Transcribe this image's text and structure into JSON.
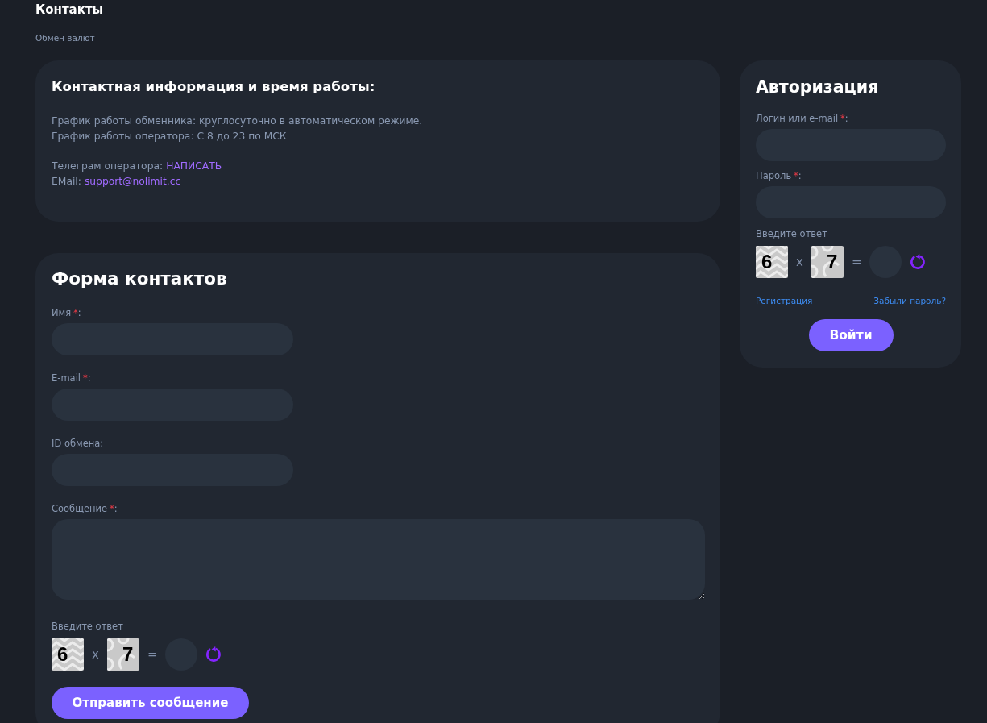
{
  "page": {
    "title": "Контакты",
    "breadcrumb": "Обмен валют"
  },
  "contact_info": {
    "title": "Контактная информация и время работы:",
    "schedule": [
      {
        "text": "График работы обменника: круглосуточно в автоматическом режиме."
      },
      {
        "text": "График работы оператора: С 8 до 23 по МСК"
      }
    ],
    "contacts": [
      {
        "label": "Телеграм оператора:",
        "link": "НАПИСАТЬ"
      },
      {
        "label": "EMail:",
        "link": "support@nolimit.cc"
      }
    ]
  },
  "contact_form": {
    "title": "Форма контактов",
    "fields": [
      {
        "kind": "input",
        "label": "Имя",
        "required_mark": "*",
        "colon": ":"
      },
      {
        "kind": "input",
        "label": "E-mail",
        "required_mark": "*",
        "colon": ":"
      },
      {
        "kind": "input",
        "label": "ID обмена",
        "colon": ":"
      },
      {
        "kind": "textarea",
        "label": "Сообщение",
        "required_mark": "*",
        "colon": ":"
      }
    ],
    "captcha": {
      "label": "Введите ответ",
      "operands": [
        {
          "digit": "6",
          "kind": "zigzag"
        },
        {
          "digit": "7",
          "kind": "rings"
        }
      ],
      "operator": "x",
      "equals": "="
    },
    "submit": "Отправить сообщение"
  },
  "auth": {
    "title": "Авторизация",
    "fields": [
      {
        "kind": "input",
        "label": "Логин или e-mail",
        "required_mark": "*",
        "colon": ":"
      },
      {
        "kind": "input",
        "label": "Пароль",
        "required_mark": "*",
        "colon": ":"
      }
    ],
    "captcha": {
      "label": "Введите ответ",
      "operands": [
        {
          "digit": "6",
          "kind": "zigzag"
        },
        {
          "digit": "7",
          "kind": "rings"
        }
      ],
      "operator": "x",
      "equals": "="
    },
    "links": [
      {
        "text": "Регистрация"
      },
      {
        "text": "Забыли пароль?"
      }
    ],
    "submit": "Войти"
  }
}
